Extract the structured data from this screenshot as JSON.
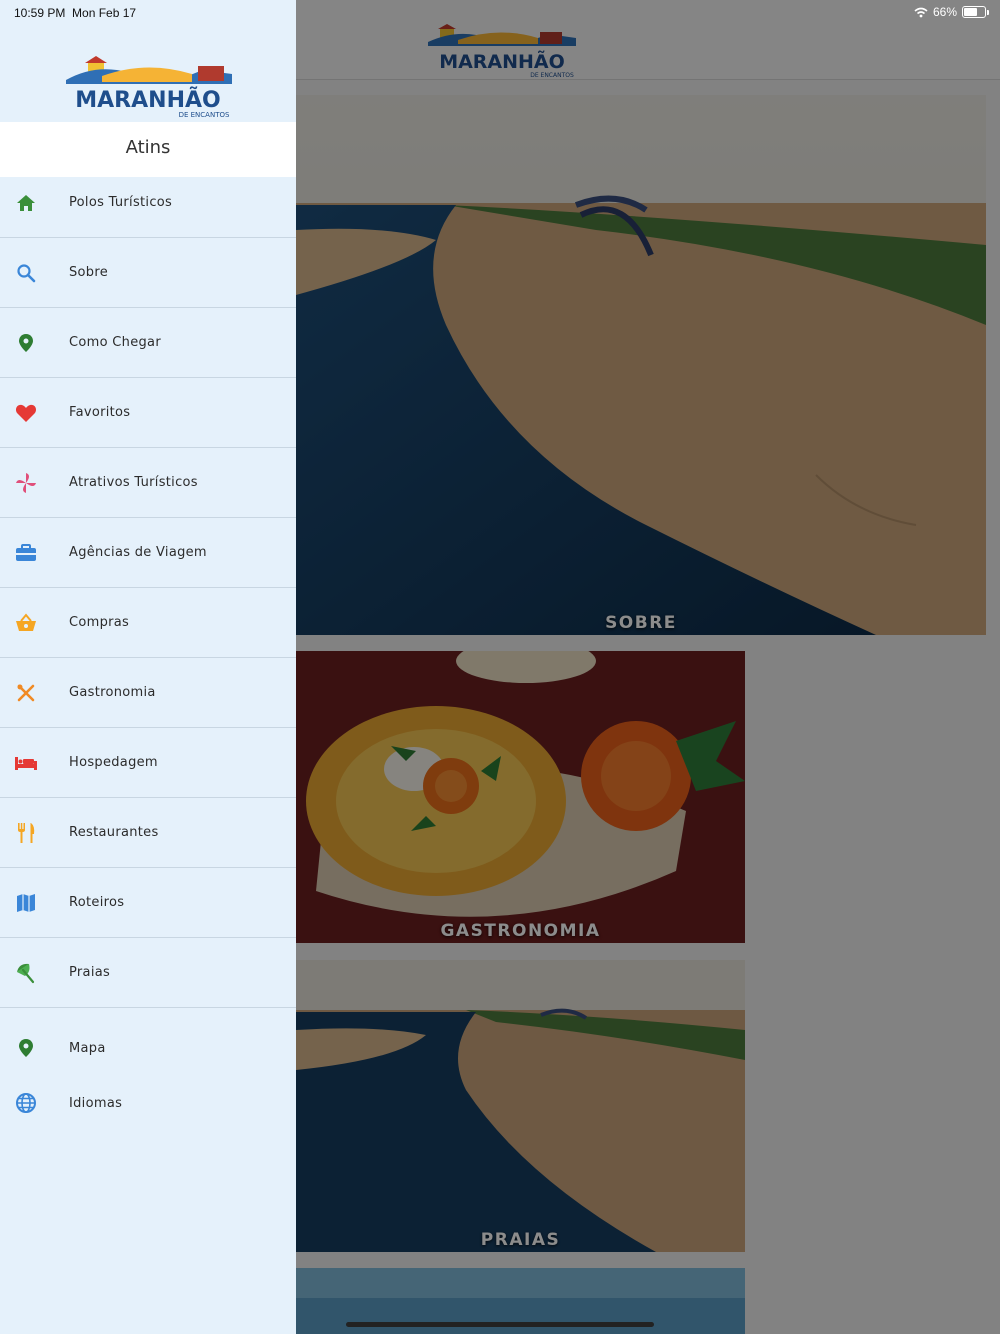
{
  "status_bar": {
    "time": "10:59 PM",
    "date": "Mon Feb 17",
    "battery_percent": "66%",
    "battery_level": 0.66
  },
  "brand": {
    "logo_text": "MARANHÃO",
    "logo_tagline": "DE ENCANTOS"
  },
  "drawer": {
    "city": "Atins",
    "items": [
      {
        "label": "Polos Turísticos",
        "icon": "home-icon",
        "color": "#3a8f3a"
      },
      {
        "label": "Sobre",
        "icon": "search-icon",
        "color": "#3a86d8"
      },
      {
        "label": "Como Chegar",
        "icon": "location-pin-icon",
        "color": "#2e7d32"
      },
      {
        "label": "Favoritos",
        "icon": "heart-icon",
        "color": "#e53935"
      },
      {
        "label": "Atrativos Turísticos",
        "icon": "pinwheel-icon",
        "color": "#e04f7a"
      },
      {
        "label": "Agências de Viagem",
        "icon": "briefcase-icon",
        "color": "#3a86d8"
      },
      {
        "label": "Compras",
        "icon": "basket-icon",
        "color": "#f5a623"
      },
      {
        "label": "Gastronomia",
        "icon": "utensils-crossed-icon",
        "color": "#f08a24"
      },
      {
        "label": "Hospedagem",
        "icon": "bed-icon",
        "color": "#e53935"
      },
      {
        "label": "Restaurantes",
        "icon": "fork-knife-icon",
        "color": "#f5a623"
      },
      {
        "label": "Roteiros",
        "icon": "map-icon",
        "color": "#3a86d8"
      },
      {
        "label": "Praias",
        "icon": "beach-umbrella-icon",
        "color": "#3a8f3a"
      },
      {
        "label": "Mapa",
        "icon": "location-pin-icon",
        "color": "#2e7d32"
      },
      {
        "label": "Idiomas",
        "icon": "globe-icon",
        "color": "#3a86d8"
      }
    ]
  },
  "cards": [
    {
      "caption": "SOBRE"
    },
    {
      "caption": "GASTRONOMIA"
    },
    {
      "caption": "PRAIAS"
    }
  ]
}
